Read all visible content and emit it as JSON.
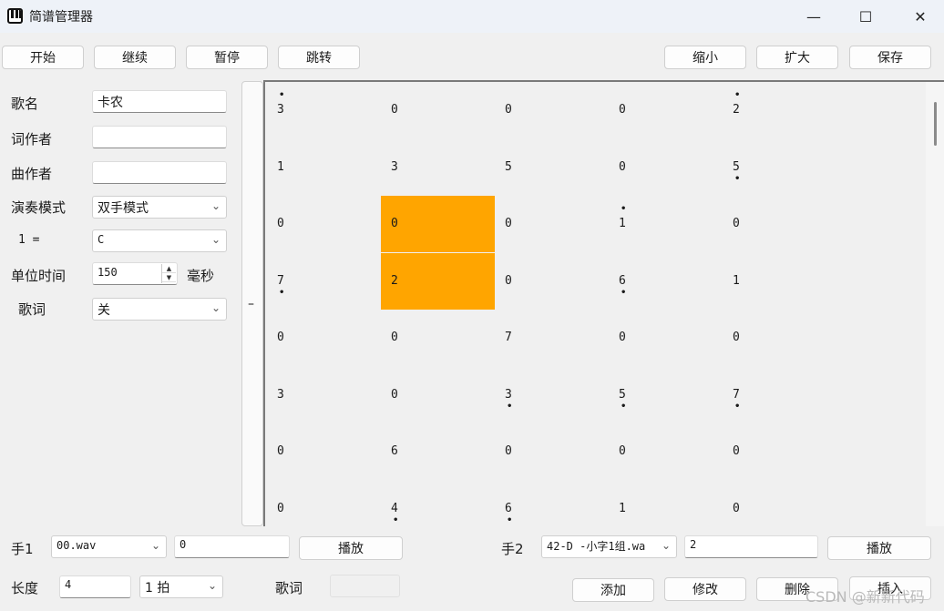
{
  "window": {
    "title": "简谱管理器",
    "minimize": "—",
    "maximize": "☐",
    "close": "✕"
  },
  "toolbar": {
    "start": "开始",
    "continue": "继续",
    "pause": "暂停",
    "jump": "跳转",
    "shrink": "缩小",
    "expand": "扩大",
    "save": "保存"
  },
  "form": {
    "song_name_label": "歌名",
    "song_name_value": "卡农",
    "lyricist_label": "词作者",
    "lyricist_value": "",
    "composer_label": "曲作者",
    "composer_value": "",
    "mode_label": "演奏模式",
    "mode_value": "双手模式",
    "key_label": "1 =",
    "key_value": "C",
    "unit_time_label": "单位时间",
    "unit_time_value": "150",
    "unit_time_unit": "毫秒",
    "lyrics_label": "歌词",
    "lyrics_value": "关"
  },
  "splitter_label": "–",
  "score": {
    "selected": [
      [
        2,
        1
      ],
      [
        3,
        1
      ]
    ],
    "rows": [
      [
        {
          "n": "3",
          "up": true
        },
        {
          "n": "0"
        },
        {
          "n": "0"
        },
        {
          "n": "0"
        },
        {
          "n": "2",
          "up": true
        }
      ],
      [
        {
          "n": "1"
        },
        {
          "n": "3"
        },
        {
          "n": "5"
        },
        {
          "n": "0"
        },
        {
          "n": "5",
          "down": true
        }
      ],
      [
        {
          "n": "0"
        },
        {
          "n": "0"
        },
        {
          "n": "0"
        },
        {
          "n": "1",
          "up": true
        },
        {
          "n": "0"
        }
      ],
      [
        {
          "n": "7",
          "down": true
        },
        {
          "n": "2"
        },
        {
          "n": "0"
        },
        {
          "n": "6",
          "down": true
        },
        {
          "n": "1"
        }
      ],
      [
        {
          "n": "0"
        },
        {
          "n": "0"
        },
        {
          "n": "7"
        },
        {
          "n": "0"
        },
        {
          "n": "0"
        }
      ],
      [
        {
          "n": "3"
        },
        {
          "n": "0"
        },
        {
          "n": "3",
          "down": true
        },
        {
          "n": "5",
          "down": true
        },
        {
          "n": "7",
          "down": true
        }
      ],
      [
        {
          "n": "0"
        },
        {
          "n": "6"
        },
        {
          "n": "0"
        },
        {
          "n": "0"
        },
        {
          "n": "0"
        }
      ],
      [
        {
          "n": "0"
        },
        {
          "n": "4",
          "down": true
        },
        {
          "n": "6",
          "down": true
        },
        {
          "n": "1"
        },
        {
          "n": "0"
        }
      ]
    ]
  },
  "hand1": {
    "label": "手1",
    "sound": "00.wav",
    "value": "0",
    "play": "播放"
  },
  "hand2": {
    "label": "手2",
    "sound": "42-D -小字1组.wa",
    "value": "2",
    "play": "播放"
  },
  "bottom": {
    "length_label": "长度",
    "length_value": "4",
    "beat_value": "1 拍",
    "lyric_label": "歌词",
    "lyric_value": "",
    "add": "添加",
    "modify": "修改",
    "delete": "删除",
    "insert": "插入"
  },
  "watermark": "CSDN @新新代码"
}
